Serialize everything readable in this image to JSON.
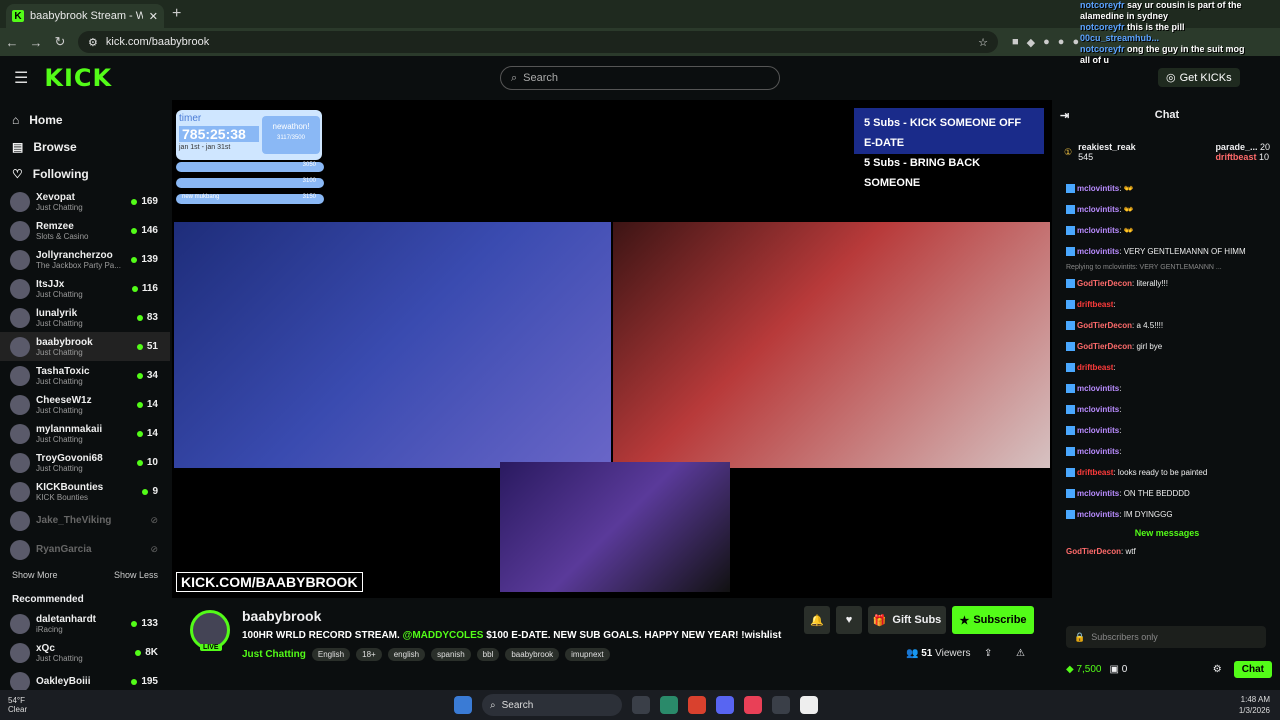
{
  "browser": {
    "tab_title": "baabybrook Stream - Watch",
    "url": "kick.com/baabybrook"
  },
  "header": {
    "search_placeholder": "Search",
    "get_kicks": "Get KICKs",
    "chat_title": "Chat"
  },
  "nav": {
    "home": "Home",
    "browse": "Browse",
    "following": "Following"
  },
  "following": [
    {
      "name": "Xevopat",
      "cat": "Just Chatting",
      "viewers": "169"
    },
    {
      "name": "Remzee",
      "cat": "Slots & Casino",
      "viewers": "146"
    },
    {
      "name": "Jollyrancherzoo",
      "cat": "The Jackbox Party Pa...",
      "viewers": "139"
    },
    {
      "name": "ItsJJx",
      "cat": "Just Chatting",
      "viewers": "116"
    },
    {
      "name": "lunalyrik",
      "cat": "Just Chatting",
      "viewers": "83"
    },
    {
      "name": "baabybrook",
      "cat": "Just Chatting",
      "viewers": "51"
    },
    {
      "name": "TashaToxic",
      "cat": "Just Chatting",
      "viewers": "34"
    },
    {
      "name": "CheeseW1z",
      "cat": "Just Chatting",
      "viewers": "14"
    },
    {
      "name": "mylannmakaii",
      "cat": "Just Chatting",
      "viewers": "14"
    },
    {
      "name": "TroyGovoni68",
      "cat": "Just Chatting",
      "viewers": "10"
    },
    {
      "name": "KICKBounties",
      "cat": "KICK Bounties",
      "viewers": "9"
    }
  ],
  "offline": [
    {
      "name": "Jake_TheViking"
    },
    {
      "name": "RyanGarcia"
    }
  ],
  "show_more": "Show More",
  "show_less": "Show Less",
  "recommended_title": "Recommended",
  "recommended": [
    {
      "name": "daletanhardt",
      "cat": "iRacing",
      "viewers": "133"
    },
    {
      "name": "xQc",
      "cat": "Just Chatting",
      "viewers": "8K"
    },
    {
      "name": "OakleyBoiii",
      "cat": "",
      "viewers": "195"
    }
  ],
  "overlay": {
    "timer_label": "timer",
    "timer_value": "785:25:38",
    "timer_dates": "jan 1st - jan 31st",
    "newathon": "newathon!",
    "newathon_count": "3117/3500",
    "goal_values": [
      "3050",
      "3100",
      "3150"
    ],
    "goal_last": "new mukbang",
    "subs_line1": "5 Subs - KICK SOMEONE OFF E-DATE",
    "subs_line2": "5 Subs - BRING BACK SOMEONE",
    "kick_url": "KICK.COM/BAABYBROOK"
  },
  "stream": {
    "streamer": "baabybrook",
    "live": "LIVE",
    "title_pre": "100HR WRLD RECORD STREAM. ",
    "mention": "@MADDYCOLES",
    "title_post": " $100 E-DATE. NEW SUB GOALS. HAPPY NEW YEAR! !wishlist ...",
    "category": "Just Chatting",
    "tags": [
      "English",
      "18+",
      "english",
      "spanish",
      "bbl",
      "baabybrook",
      "imupnext"
    ],
    "gift_subs": "Gift Subs",
    "subscribe": "Subscribe",
    "viewers": "51",
    "viewers_label": "Viewers"
  },
  "chat": {
    "pinned": [
      {
        "name": "reakiest_reak",
        "count": "545"
      },
      {
        "name": "parade_...",
        "count": "20"
      },
      {
        "name": "driftbeast",
        "count": "10"
      }
    ],
    "messages": [
      {
        "user": "mclovintits",
        "color": "#b98cff",
        "text": "👐"
      },
      {
        "user": "mclovintits",
        "color": "#b98cff",
        "text": "👐"
      },
      {
        "user": "mclovintits",
        "color": "#b98cff",
        "text": "👐"
      },
      {
        "user": "mclovintits",
        "color": "#b98cff",
        "text": "VERY GENTLEMANNN OF HIMM"
      },
      {
        "reply": "Replying to mclovintits: VERY GENTLEMANNN ...",
        "user": "GodTierDecon",
        "color": "#ff6b6b",
        "text": "literally!!!"
      },
      {
        "user": "driftbeast",
        "color": "#ff3b3b",
        "text": ""
      },
      {
        "user": "GodTierDecon",
        "color": "#ff6b6b",
        "text": "a 4.5!!!!"
      },
      {
        "user": "GodTierDecon",
        "color": "#ff6b6b",
        "text": "girl bye"
      },
      {
        "user": "driftbeast",
        "color": "#ff3b3b",
        "text": ""
      },
      {
        "user": "mclovintits",
        "color": "#b98cff",
        "text": ""
      },
      {
        "user": "mclovintits",
        "color": "#b98cff",
        "text": ""
      },
      {
        "user": "mclovintits",
        "color": "#b98cff",
        "text": ""
      },
      {
        "user": "mclovintits",
        "color": "#b98cff",
        "text": ""
      },
      {
        "user": "driftbeast",
        "color": "#ff3b3b",
        "text": "looks ready to be painted"
      },
      {
        "user": "mclovintits",
        "color": "#b98cff",
        "text": "ON THE BEDDDD"
      },
      {
        "user": "mclovintits",
        "color": "#b98cff",
        "text": "IM DYINGGG"
      }
    ],
    "new_messages": "New messages",
    "last": {
      "user": "GodTierDecon",
      "color": "#ff6b6b",
      "text": "wtf"
    },
    "subscribers_only": "Subscribers only",
    "kicks": "7,500",
    "zero": "0",
    "chat_button": "Chat"
  },
  "side_overlay": [
    {
      "u": "notcoreyfr",
      "t": "say ur cousin is part of the"
    },
    {
      "u": "",
      "t": "alamedine in sydney"
    },
    {
      "u": "notcoreyfr",
      "t": "this is the pill"
    },
    {
      "u": "00cu_streamhub...",
      "t": ""
    },
    {
      "u": "notcoreyfr",
      "t": "ong the guy in the suit mog"
    },
    {
      "u": "",
      "t": "all of u"
    }
  ],
  "taskbar": {
    "temp": "54°F",
    "weather": "Clear",
    "search": "Search",
    "time": "1:48 AM",
    "date": "1/3/2026"
  }
}
